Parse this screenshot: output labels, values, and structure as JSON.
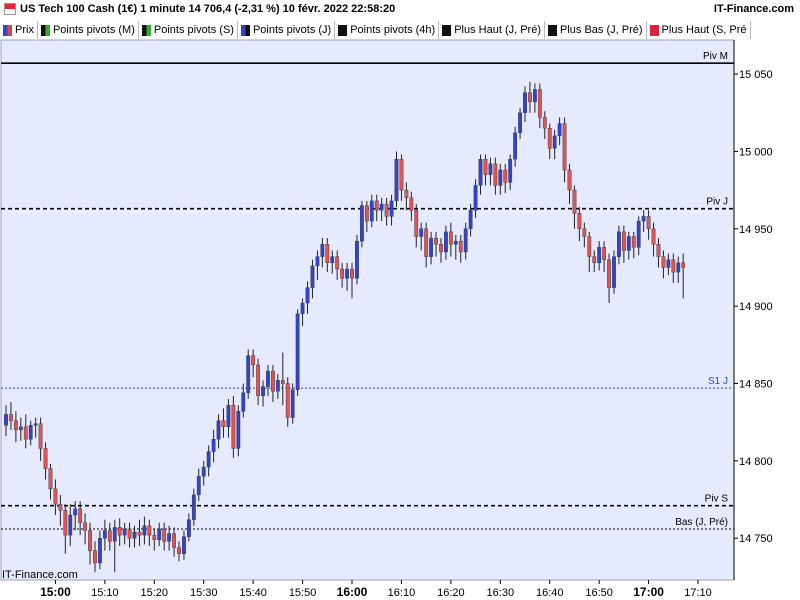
{
  "header": {
    "title": "US Tech 100 Cash (1€) 1 minute 14 706,4 (-2,31 %) 10 févr. 2022 22:58:20",
    "brand": "IT-Finance.com"
  },
  "legend": [
    {
      "label": "Prix",
      "color": "#3344cc",
      "color2": "#dd4444"
    },
    {
      "label": "Points pivots (M)",
      "color": "#111111",
      "color2": "#33aa33"
    },
    {
      "label": "Points pivots (S)",
      "color": "#111111",
      "color2": "#33aa33"
    },
    {
      "label": "Points pivots (J)",
      "color": "#3344cc",
      "color2": "#111111"
    },
    {
      "label": "Points pivots (4h)",
      "color": "#111111",
      "color2": "#111111"
    },
    {
      "label": "Plus Haut (J, Pré)",
      "color": "#111111",
      "color2": "#111111"
    },
    {
      "label": "Plus Bas (J, Pré)",
      "color": "#111111",
      "color2": "#111111"
    },
    {
      "label": "Plus Haut (S, Pré",
      "color": "#dd2244",
      "color2": "#dd2244"
    }
  ],
  "watermark": "IT-Finance.com",
  "chart_data": {
    "type": "candlestick",
    "colors": {
      "up": "#3344cc",
      "down": "#dd5555",
      "plot_bg": "#e6eafe"
    },
    "ylim": [
      14723,
      15072
    ],
    "y_ticks": [
      "14 750",
      "14 800",
      "14 850",
      "14 900",
      "14 950",
      "15 000",
      "15 050"
    ],
    "y_tick_values": [
      14750,
      14800,
      14850,
      14900,
      14950,
      15000,
      15050
    ],
    "x_ticks": [
      {
        "label": "15:00",
        "bold": true
      },
      {
        "label": "15:10",
        "bold": false
      },
      {
        "label": "15:20",
        "bold": false
      },
      {
        "label": "15:30",
        "bold": false
      },
      {
        "label": "15:40",
        "bold": false
      },
      {
        "label": "15:50",
        "bold": false
      },
      {
        "label": "16:00",
        "bold": true
      },
      {
        "label": "16:10",
        "bold": false
      },
      {
        "label": "16:20",
        "bold": false
      },
      {
        "label": "16:30",
        "bold": false
      },
      {
        "label": "16:40",
        "bold": false
      },
      {
        "label": "16:50",
        "bold": false
      },
      {
        "label": "17:00",
        "bold": true
      },
      {
        "label": "17:10",
        "bold": false
      }
    ],
    "levels": [
      {
        "label": "Piv M",
        "value": 15057,
        "style": "solid",
        "color": "#000000"
      },
      {
        "label": "Piv J",
        "value": 14963,
        "style": "dashed",
        "color": "#000000"
      },
      {
        "label": "S1 J",
        "value": 14847,
        "style": "dotted",
        "color": "#3344cc"
      },
      {
        "label": "Piv S",
        "value": 14771,
        "style": "dashed",
        "color": "#000000"
      },
      {
        "label": "Bas (J, Pré)",
        "value": 14756,
        "style": "dotted",
        "color": "#000000"
      }
    ],
    "candles": [
      [
        14823,
        14830,
        14820,
        14836,
        14816
      ],
      [
        14830,
        14826,
        14822,
        14838,
        14820
      ],
      [
        14826,
        14820,
        14815,
        14832,
        14812
      ],
      [
        14820,
        14822,
        14816,
        14828,
        14813
      ],
      [
        14822,
        14814,
        14810,
        14830,
        14808
      ],
      [
        14814,
        14823,
        14812,
        14826,
        14810
      ],
      [
        14823,
        14824,
        14818,
        14828,
        14815
      ],
      [
        14824,
        14808,
        14805,
        14828,
        14800
      ],
      [
        14808,
        14795,
        14790,
        14812,
        14788
      ],
      [
        14795,
        14782,
        14778,
        14798,
        14775
      ],
      [
        14782,
        14772,
        14768,
        14788,
        14765
      ],
      [
        14772,
        14768,
        14762,
        14778,
        14758
      ],
      [
        14768,
        14752,
        14750,
        14772,
        14740
      ],
      [
        14752,
        14765,
        14750,
        14772,
        14745
      ],
      [
        14765,
        14769,
        14760,
        14774,
        14755
      ],
      [
        14769,
        14760,
        14756,
        14774,
        14752
      ],
      [
        14760,
        14755,
        14750,
        14766,
        14746
      ],
      [
        14755,
        14742,
        14740,
        14760,
        14733
      ],
      [
        14742,
        14734,
        14732,
        14748,
        14728
      ],
      [
        14734,
        14750,
        14732,
        14755,
        14730
      ],
      [
        14750,
        14755,
        14745,
        14762,
        14742
      ],
      [
        14755,
        14748,
        14745,
        14760,
        14742
      ],
      [
        14748,
        14757,
        14746,
        14762,
        14728
      ],
      [
        14757,
        14752,
        14748,
        14763,
        14745
      ],
      [
        14752,
        14756,
        14749,
        14760,
        14746
      ],
      [
        14756,
        14750,
        14747,
        14760,
        14744
      ],
      [
        14750,
        14754,
        14747,
        14758,
        14744
      ],
      [
        14754,
        14752,
        14748,
        14762,
        14745
      ],
      [
        14752,
        14758,
        14749,
        14764,
        14746
      ],
      [
        14758,
        14752,
        14748,
        14762,
        14745
      ],
      [
        14752,
        14749,
        14746,
        14756,
        14742
      ],
      [
        14749,
        14756,
        14747,
        14760,
        14745
      ],
      [
        14756,
        14748,
        14745,
        14760,
        14742
      ],
      [
        14748,
        14753,
        14745,
        14758,
        14742
      ],
      [
        14753,
        14744,
        14741,
        14757,
        14738
      ],
      [
        14744,
        14740,
        14737,
        14748,
        14735
      ],
      [
        14740,
        14751,
        14738,
        14755,
        14736
      ],
      [
        14751,
        14762,
        14749,
        14766,
        14748
      ],
      [
        14762,
        14778,
        14760,
        14782,
        14758
      ],
      [
        14778,
        14790,
        14776,
        14795,
        14774
      ],
      [
        14790,
        14796,
        14786,
        14800,
        14784
      ],
      [
        14796,
        14806,
        14793,
        14810,
        14790
      ],
      [
        14806,
        14814,
        14802,
        14820,
        14799
      ],
      [
        14814,
        14826,
        14812,
        14830,
        14808
      ],
      [
        14826,
        14822,
        14818,
        14834,
        14815
      ],
      [
        14822,
        14836,
        14818,
        14840,
        14815
      ],
      [
        14836,
        14808,
        14805,
        14842,
        14802
      ],
      [
        14808,
        14832,
        14806,
        14836,
        14803
      ],
      [
        14832,
        14844,
        14830,
        14850,
        14828
      ],
      [
        14844,
        14868,
        14842,
        14872,
        14840
      ],
      [
        14868,
        14862,
        14858,
        14872,
        14854
      ],
      [
        14862,
        14842,
        14840,
        14866,
        14836
      ],
      [
        14842,
        14848,
        14838,
        14852,
        14835
      ],
      [
        14848,
        14858,
        14845,
        14862,
        14842
      ],
      [
        14858,
        14845,
        14842,
        14862,
        14838
      ],
      [
        14845,
        14852,
        14842,
        14856,
        14840
      ],
      [
        14852,
        14850,
        14840,
        14870,
        14836
      ],
      [
        14850,
        14828,
        14825,
        14854,
        14822
      ],
      [
        14828,
        14846,
        14826,
        14850,
        14824
      ],
      [
        14846,
        14895,
        14844,
        14898,
        14842
      ],
      [
        14895,
        14902,
        14890,
        14905,
        14887
      ],
      [
        14902,
        14912,
        14898,
        14916,
        14895
      ],
      [
        14912,
        14926,
        14908,
        14930,
        14905
      ],
      [
        14926,
        14932,
        14920,
        14936,
        14917
      ],
      [
        14932,
        14940,
        14928,
        14944,
        14925
      ],
      [
        14940,
        14928,
        14925,
        14944,
        14922
      ],
      [
        14928,
        14932,
        14924,
        14936,
        14921
      ],
      [
        14932,
        14924,
        14920,
        14936,
        14917
      ],
      [
        14924,
        14918,
        14915,
        14928,
        14912
      ],
      [
        14918,
        14924,
        14915,
        14928,
        14910
      ],
      [
        14924,
        14918,
        14914,
        14928,
        14905
      ],
      [
        14918,
        14942,
        14916,
        14946,
        14914
      ],
      [
        14942,
        14965,
        14940,
        14968,
        14938
      ],
      [
        14965,
        14955,
        14952,
        14968,
        14948
      ],
      [
        14955,
        14968,
        14953,
        14972,
        14951
      ],
      [
        14968,
        14962,
        14958,
        14972,
        14955
      ],
      [
        14962,
        14966,
        14958,
        14970,
        14955
      ],
      [
        14966,
        14958,
        14955,
        14970,
        14952
      ],
      [
        14958,
        14968,
        14955,
        14972,
        14952
      ],
      [
        14968,
        14995,
        14966,
        15000,
        14964
      ],
      [
        14995,
        14975,
        14972,
        14998,
        14968
      ],
      [
        14975,
        14970,
        14966,
        14980,
        14962
      ],
      [
        14970,
        14962,
        14958,
        14974,
        14955
      ],
      [
        14962,
        14945,
        14942,
        14966,
        14938
      ],
      [
        14945,
        14950,
        14940,
        14954,
        14936
      ],
      [
        14950,
        14932,
        14928,
        14954,
        14925
      ],
      [
        14932,
        14944,
        14930,
        14948,
        14927
      ],
      [
        14944,
        14940,
        14936,
        14948,
        14932
      ],
      [
        14940,
        14935,
        14932,
        14944,
        14928
      ],
      [
        14935,
        14948,
        14933,
        14952,
        14930
      ],
      [
        14948,
        14940,
        14936,
        14954,
        14932
      ],
      [
        14940,
        14942,
        14934,
        14946,
        14930
      ],
      [
        14942,
        14935,
        14932,
        14946,
        14928
      ],
      [
        14935,
        14950,
        14933,
        14954,
        14930
      ],
      [
        14950,
        14962,
        14948,
        14966,
        14945
      ],
      [
        14962,
        14978,
        14960,
        14982,
        14957
      ],
      [
        14978,
        14995,
        14975,
        14998,
        14972
      ],
      [
        14995,
        14985,
        14982,
        14998,
        14978
      ],
      [
        14985,
        14992,
        14982,
        14996,
        14978
      ],
      [
        14992,
        14978,
        14975,
        14996,
        14972
      ],
      [
        14978,
        14988,
        14975,
        14992,
        14972
      ],
      [
        14988,
        14980,
        14976,
        14992,
        14973
      ],
      [
        14980,
        14995,
        14978,
        14998,
        14975
      ],
      [
        14995,
        15012,
        14992,
        15016,
        14990
      ],
      [
        15012,
        15025,
        15010,
        15028,
        15008
      ],
      [
        15025,
        15038,
        15022,
        15042,
        15019
      ],
      [
        15038,
        15032,
        15028,
        15045,
        15025
      ],
      [
        15032,
        15040,
        15028,
        15044,
        15025
      ],
      [
        15040,
        15022,
        15018,
        15044,
        15015
      ],
      [
        15022,
        15015,
        15012,
        15026,
        15008
      ],
      [
        15015,
        15002,
        14998,
        15018,
        14995
      ],
      [
        15002,
        15010,
        14998,
        15014,
        14995
      ],
      [
        15010,
        15018,
        15007,
        15022,
        15004
      ],
      [
        15018,
        14988,
        14985,
        15022,
        14980
      ],
      [
        14988,
        14975,
        14970,
        14992,
        14966
      ],
      [
        14975,
        14960,
        14955,
        14978,
        14950
      ],
      [
        14960,
        14950,
        14945,
        14964,
        14942
      ],
      [
        14950,
        14945,
        14942,
        14954,
        14938
      ],
      [
        14945,
        14932,
        14928,
        14948,
        14922
      ],
      [
        14932,
        14928,
        14925,
        14936,
        14922
      ],
      [
        14928,
        14938,
        14926,
        14942,
        14923
      ],
      [
        14938,
        14930,
        14926,
        14942,
        14922
      ],
      [
        14930,
        14912,
        14910,
        14934,
        14902
      ],
      [
        14912,
        14932,
        14910,
        14936,
        14908
      ],
      [
        14932,
        14948,
        14930,
        14952,
        14927
      ],
      [
        14948,
        14936,
        14932,
        14952,
        14928
      ],
      [
        14936,
        14945,
        14933,
        14948,
        14930
      ],
      [
        14945,
        14938,
        14934,
        14948,
        14931
      ],
      [
        14938,
        14955,
        14936,
        14958,
        14933
      ],
      [
        14955,
        14958,
        14950,
        14962,
        14948
      ],
      [
        14958,
        14950,
        14946,
        14962,
        14943
      ],
      [
        14950,
        14940,
        14936,
        14954,
        14932
      ],
      [
        14940,
        14932,
        14928,
        14944,
        14925
      ],
      [
        14932,
        14925,
        14922,
        14936,
        14918
      ],
      [
        14925,
        14930,
        14922,
        14934,
        14920
      ],
      [
        14930,
        14922,
        14918,
        14934,
        14915
      ],
      [
        14922,
        14928,
        14918,
        14932,
        14915
      ],
      [
        14928,
        14925,
        14918,
        14934,
        14905
      ]
    ]
  }
}
